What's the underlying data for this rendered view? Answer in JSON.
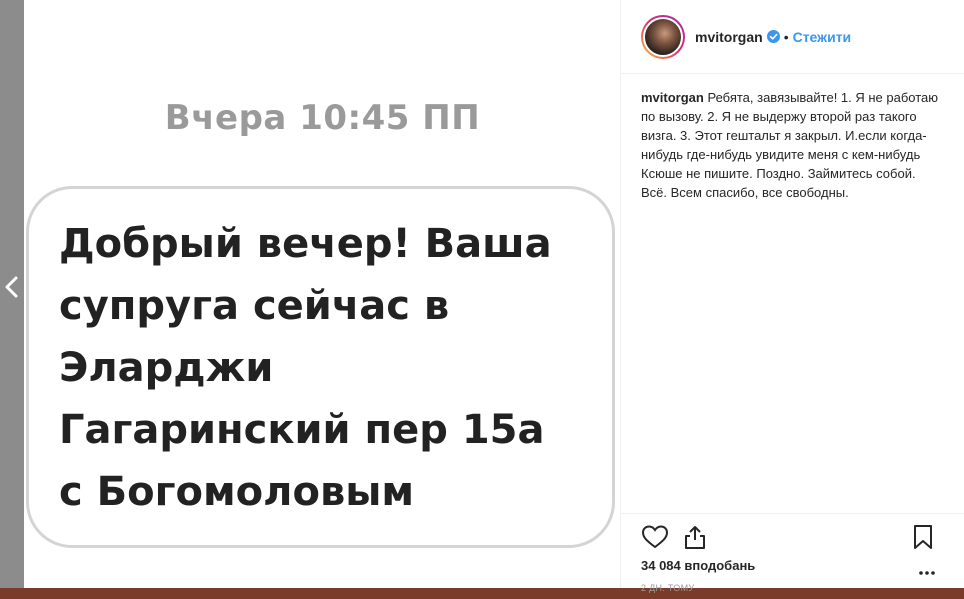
{
  "post": {
    "message_time": "Вчера 10:45 ПП",
    "message_text": "Добрый вечер! Ваша\nсупруга сейчас в\nЭларджи\nГагаринский пер 15а\nс Богомоловым"
  },
  "header": {
    "username": "mvitorgan",
    "separator": "•",
    "follow_label": "Стежити"
  },
  "caption": {
    "username": "mvitorgan",
    "text": "Ребята, завязывайте! 1. Я не работаю по вызову. 2. Я не выдержу второй раз такого визга. 3. Этот гештальт я закрыл. И.если когда-нибудь где-нибудь увидите меня с кем-нибудь Ксюше не пишите. Поздно. Займитесь собой. Всё. Всем спасибо, все свободны."
  },
  "stats": {
    "likes": "34 084 вподобань",
    "time_ago": "2 дн. тому"
  },
  "icons": [
    "chevron-left-icon",
    "verified-icon",
    "heart-icon",
    "share-icon",
    "bookmark-icon",
    "more-icon"
  ],
  "colors": {
    "follow": "#3897f0",
    "verified": "#3897f0",
    "text": "#262626"
  }
}
